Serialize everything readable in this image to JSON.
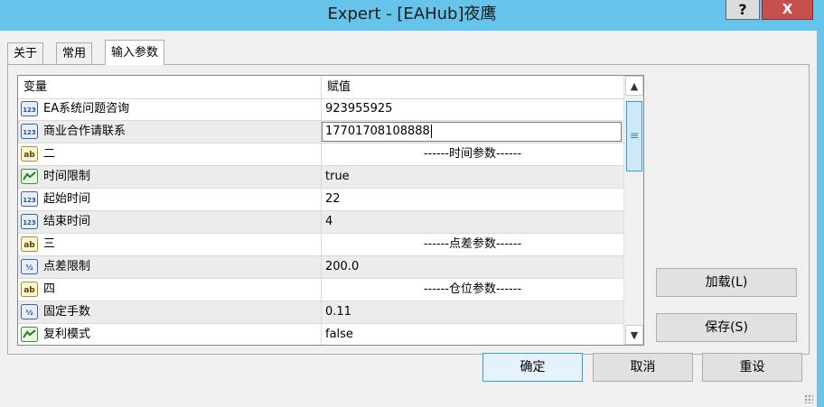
{
  "window": {
    "title": "Expert - [EAHub]夜鹰",
    "help_label": "?",
    "close_label": "X"
  },
  "tabs": [
    {
      "label": "关于",
      "active": false
    },
    {
      "label": "常用",
      "active": false
    },
    {
      "label": "输入参数",
      "active": true
    }
  ],
  "grid": {
    "columns": [
      "变量",
      "赋值"
    ],
    "rows": [
      {
        "type": "int",
        "variable": "EA系统问题咨询",
        "value": "923955925"
      },
      {
        "type": "int",
        "variable": "商业合作请联系",
        "value": "17701708108888",
        "editing": true
      },
      {
        "type": "string",
        "variable": "二",
        "value": "------时间参数------"
      },
      {
        "type": "bool",
        "variable": "时间限制",
        "value": "true"
      },
      {
        "type": "int",
        "variable": "起始时间",
        "value": "22"
      },
      {
        "type": "int",
        "variable": "结束时间",
        "value": "4"
      },
      {
        "type": "string",
        "variable": "三",
        "value": "------点差参数------"
      },
      {
        "type": "double",
        "variable": "点差限制",
        "value": "200.0"
      },
      {
        "type": "string",
        "variable": "四",
        "value": "------仓位参数------"
      },
      {
        "type": "double",
        "variable": "固定手数",
        "value": "0.11"
      },
      {
        "type": "bool",
        "variable": "复利模式",
        "value": "false"
      }
    ],
    "type_icons": {
      "int": "integer-123-icon",
      "string": "string-ab-icon",
      "bool": "boolean-chart-icon",
      "double": "double-half-icon"
    }
  },
  "side_buttons": {
    "load": "加载(L)",
    "save": "保存(S)"
  },
  "bottom_buttons": {
    "ok": "确定",
    "cancel": "取消",
    "reset": "重设"
  },
  "colors": {
    "title_bar": "#66c4ea",
    "close_button": "#c7504f",
    "selection_border": "#3c9ad6"
  }
}
